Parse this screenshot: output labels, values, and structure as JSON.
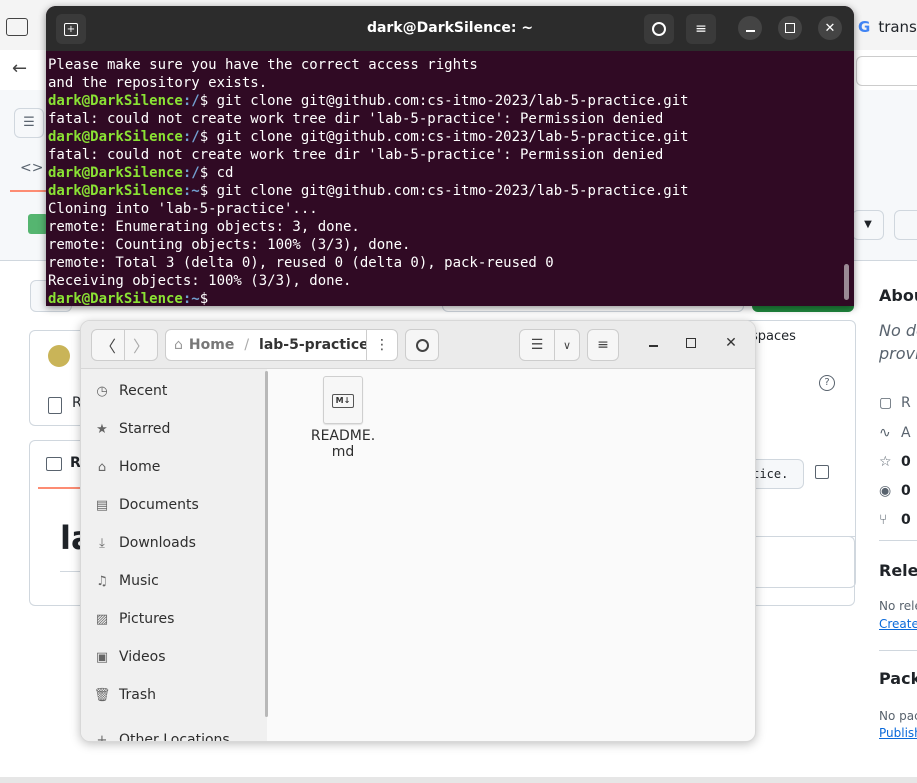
{
  "browser": {
    "tab_label": "trans",
    "tab_icon": "G"
  },
  "github": {
    "right_panel": {
      "about_heading": "Abou",
      "about_desc_line1": "No de",
      "about_desc_line2": "provic",
      "readme_link": "R",
      "activity_link": "A",
      "stars": "0",
      "watchers": "0",
      "forks": "0",
      "releases_heading": "Relea",
      "no_releases": "No rele",
      "create_link": "Create",
      "packages_heading": "Pack",
      "no_packages": "No pac",
      "publish_link": "Publish"
    },
    "codespaces_tab": "spaces",
    "clone_url_fragment": "ctice.",
    "readme_file_row": "R",
    "readme_tab": "R",
    "repo_title_fragment": "la"
  },
  "terminal": {
    "title": "dark@DarkSilence: ~",
    "lines": [
      {
        "type": "out",
        "text": "Please make sure you have the correct access rights"
      },
      {
        "type": "out",
        "text": "and the repository exists."
      },
      {
        "type": "prompt",
        "user": "dark@DarkSilence",
        "path": ":/",
        "cmd": "$ git clone git@github.com:cs-itmo-2023/lab-5-practice.git"
      },
      {
        "type": "out",
        "text": "fatal: could not create work tree dir 'lab-5-practice': Permission denied"
      },
      {
        "type": "prompt",
        "user": "dark@DarkSilence",
        "path": ":/",
        "cmd": "$ git clone git@github.com:cs-itmo-2023/lab-5-practice.git"
      },
      {
        "type": "out",
        "text": "fatal: could not create work tree dir 'lab-5-practice': Permission denied"
      },
      {
        "type": "prompt",
        "user": "dark@DarkSilence",
        "path": ":/",
        "cmd": "$ cd"
      },
      {
        "type": "prompt",
        "user": "dark@DarkSilence",
        "path": ":~",
        "cmd": "$ git clone git@github.com:cs-itmo-2023/lab-5-practice.git"
      },
      {
        "type": "out",
        "text": "Cloning into 'lab-5-practice'..."
      },
      {
        "type": "out",
        "text": "remote: Enumerating objects: 3, done."
      },
      {
        "type": "out",
        "text": "remote: Counting objects: 100% (3/3), done."
      },
      {
        "type": "out",
        "text": "remote: Total 3 (delta 0), reused 0 (delta 0), pack-reused 0"
      },
      {
        "type": "out",
        "text": "Receiving objects: 100% (3/3), done."
      },
      {
        "type": "prompt",
        "user": "dark@DarkSilence",
        "path": ":~",
        "cmd": "$"
      }
    ]
  },
  "files": {
    "path_home": "Home",
    "path_separator": "/",
    "path_current": "lab-5-practice",
    "sidebar": [
      {
        "label": "Recent",
        "icon": "clock-icon",
        "glyph": "◷"
      },
      {
        "label": "Starred",
        "icon": "star-icon",
        "glyph": "★"
      },
      {
        "label": "Home",
        "icon": "home-icon",
        "glyph": "⌂"
      },
      {
        "label": "Documents",
        "icon": "document-icon",
        "glyph": "▤"
      },
      {
        "label": "Downloads",
        "icon": "download-icon",
        "glyph": "⤓"
      },
      {
        "label": "Music",
        "icon": "music-icon",
        "glyph": "♫"
      },
      {
        "label": "Pictures",
        "icon": "picture-icon",
        "glyph": "▨"
      },
      {
        "label": "Videos",
        "icon": "video-icon",
        "glyph": "▣"
      },
      {
        "label": "Trash",
        "icon": "trash-icon",
        "glyph": "🗑"
      },
      {
        "label": "Other Locations",
        "icon": "plus-icon",
        "glyph": "+"
      }
    ],
    "file_name_line1": "README.",
    "file_name_line2": "md",
    "file_badge": "M↓"
  },
  "colors": {
    "terminal_bg": "#300a24",
    "prompt_user": "#8ae234",
    "prompt_path": "#729fcf",
    "github_green": "#1f883d",
    "link_blue": "#0969da"
  }
}
